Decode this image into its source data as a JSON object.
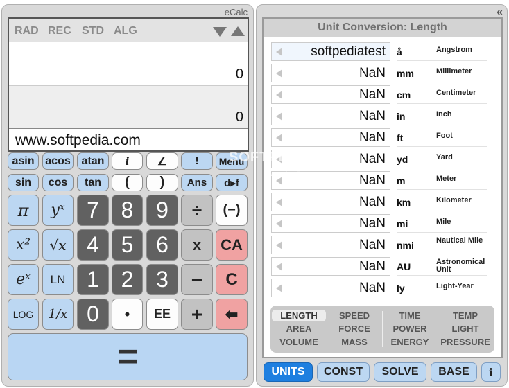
{
  "calculator": {
    "brand": "eCalc",
    "modes": [
      "RAD",
      "REC",
      "STD",
      "ALG"
    ],
    "display": {
      "line1": "0",
      "line2": "0",
      "text": "www.softpedia.com"
    },
    "buttons": {
      "asin": "asin",
      "acos": "acos",
      "atan": "atan",
      "i": "i",
      "angle": "∠",
      "fact": "!",
      "menu": "Menu",
      "sin": "sin",
      "cos": "cos",
      "tan": "tan",
      "lparen": "(",
      "rparen": ")",
      "ans": "Ans",
      "dtof": "d▸f",
      "pi": "π",
      "yx": "yˣ",
      "n7": "7",
      "n8": "8",
      "n9": "9",
      "div": "÷",
      "neg": "(−)",
      "x2": "x²",
      "sqrt": "√x",
      "n4": "4",
      "n5": "5",
      "n6": "6",
      "mul": "x",
      "ca": "CA",
      "ex": "eˣ",
      "ln": "LN",
      "n1": "1",
      "n2": "2",
      "n3": "3",
      "sub": "−",
      "c": "C",
      "log": "LOG",
      "inv": "1/x",
      "n0": "0",
      "dot": "•",
      "ee": "EE",
      "add": "+",
      "back": "⬅",
      "equals": "="
    }
  },
  "watermark": {
    "main": "SOFTPEDIA",
    "sub": "www.softpedia.com"
  },
  "converter": {
    "collapse_icon": "«",
    "title": "Unit Conversion: Length",
    "rows": [
      {
        "value": "softpediatest",
        "abbr": "å",
        "name": "Angstrom"
      },
      {
        "value": "NaN",
        "abbr": "mm",
        "name": "Millimeter"
      },
      {
        "value": "NaN",
        "abbr": "cm",
        "name": "Centimeter"
      },
      {
        "value": "NaN",
        "abbr": "in",
        "name": "Inch"
      },
      {
        "value": "NaN",
        "abbr": "ft",
        "name": "Foot"
      },
      {
        "value": "NaN",
        "abbr": "yd",
        "name": "Yard"
      },
      {
        "value": "NaN",
        "abbr": "m",
        "name": "Meter"
      },
      {
        "value": "NaN",
        "abbr": "km",
        "name": "Kilometer"
      },
      {
        "value": "NaN",
        "abbr": "mi",
        "name": "Mile"
      },
      {
        "value": "NaN",
        "abbr": "nmi",
        "name": "Nautical Mile"
      },
      {
        "value": "NaN",
        "abbr": "AU",
        "name": "Astronomical Unit"
      },
      {
        "value": "NaN",
        "abbr": "ly",
        "name": "Light-Year"
      }
    ],
    "categories": [
      [
        "LENGTH",
        "AREA",
        "VOLUME"
      ],
      [
        "SPEED",
        "FORCE",
        "MASS"
      ],
      [
        "TIME",
        "POWER",
        "ENERGY"
      ],
      [
        "TEMP",
        "LIGHT",
        "PRESSURE"
      ]
    ],
    "active_category": "LENGTH",
    "tabs": [
      "UNITS",
      "CONST",
      "SOLVE",
      "BASE",
      "i"
    ],
    "active_tab": "UNITS"
  }
}
